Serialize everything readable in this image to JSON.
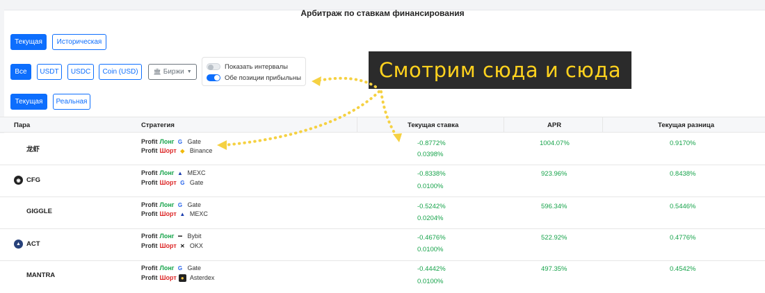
{
  "title": "Арбитраж по ставкам финансирования",
  "mode_tabs": [
    "Текущая",
    "Историческая"
  ],
  "filter_buttons": [
    "Все",
    "USDT",
    "USDC",
    "Coin (USD)"
  ],
  "exchanges_label": "Биржи",
  "toggles": {
    "show_intervals": "Показать интервалы",
    "both_profitable": "Обе позиции прибыльны"
  },
  "rate_tabs": [
    "Текущая",
    "Реальная"
  ],
  "banner": "Смотрим сюда и сюда",
  "columns": [
    "Пара",
    "Стратегия",
    "Текущая ставка",
    "APR",
    "Текущая разница"
  ],
  "labels": {
    "profit": "Profit",
    "long": "Лонг",
    "short": "Шорт"
  },
  "rows": [
    {
      "pair": "龙虾",
      "logo": "",
      "long_ex": "Gate",
      "short_ex": "Binance",
      "rate1": "-0.8772%",
      "rate2": "0.0398%",
      "apr": "1004.07%",
      "diff": "0.9170%"
    },
    {
      "pair": "CFG",
      "logo": "cfg",
      "long_ex": "MEXC",
      "short_ex": "Gate",
      "rate1": "-0.8338%",
      "rate2": "0.0100%",
      "apr": "923.96%",
      "diff": "0.8438%"
    },
    {
      "pair": "GIGGLE",
      "logo": "",
      "long_ex": "Gate",
      "short_ex": "MEXC",
      "rate1": "-0.5242%",
      "rate2": "0.0204%",
      "apr": "596.34%",
      "diff": "0.5446%"
    },
    {
      "pair": "ACT",
      "logo": "act",
      "long_ex": "Bybit",
      "short_ex": "OKX",
      "rate1": "-0.4676%",
      "rate2": "0.0100%",
      "apr": "522.92%",
      "diff": "0.4776%"
    },
    {
      "pair": "MANTRA",
      "logo": "",
      "long_ex": "Gate",
      "short_ex": "Asterdex",
      "rate1": "-0.4442%",
      "rate2": "0.0100%",
      "apr": "497.35%",
      "diff": "0.4542%"
    }
  ],
  "colors": {
    "primary": "#0d6efd",
    "positive": "#16a34a",
    "negative": "#dc2626",
    "banner_bg": "#2b2b2b",
    "banner_text": "#ffd21e",
    "arrow": "#f5d142"
  }
}
